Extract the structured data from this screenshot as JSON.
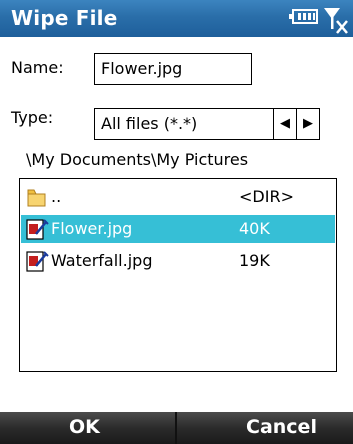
{
  "titlebar": {
    "title": "Wipe File",
    "battery_icon": "battery-icon",
    "signal_icon": "no-signal-icon"
  },
  "form": {
    "name_label": "Name:",
    "name_value": "Flower.jpg",
    "type_label": "Type:",
    "type_value": "All files (*.*)",
    "type_prev_icon": "left-arrow-icon",
    "type_next_icon": "right-arrow-icon",
    "path": "\\My Documents\\My Pictures"
  },
  "file_list": {
    "rows": [
      {
        "name": "..",
        "size": "<DIR>",
        "icon": "folder-icon",
        "selected": false
      },
      {
        "name": "Flower.jpg",
        "size": "40K",
        "icon": "image-file-icon",
        "selected": true
      },
      {
        "name": "Waterfall.jpg",
        "size": "19K",
        "icon": "image-file-icon",
        "selected": false
      }
    ]
  },
  "softkeys": {
    "left": "OK",
    "right": "Cancel"
  },
  "colors": {
    "titlebar": "#2a6ea9",
    "selection": "#36bfd6",
    "softkey_bar": "#2b2b2b"
  }
}
